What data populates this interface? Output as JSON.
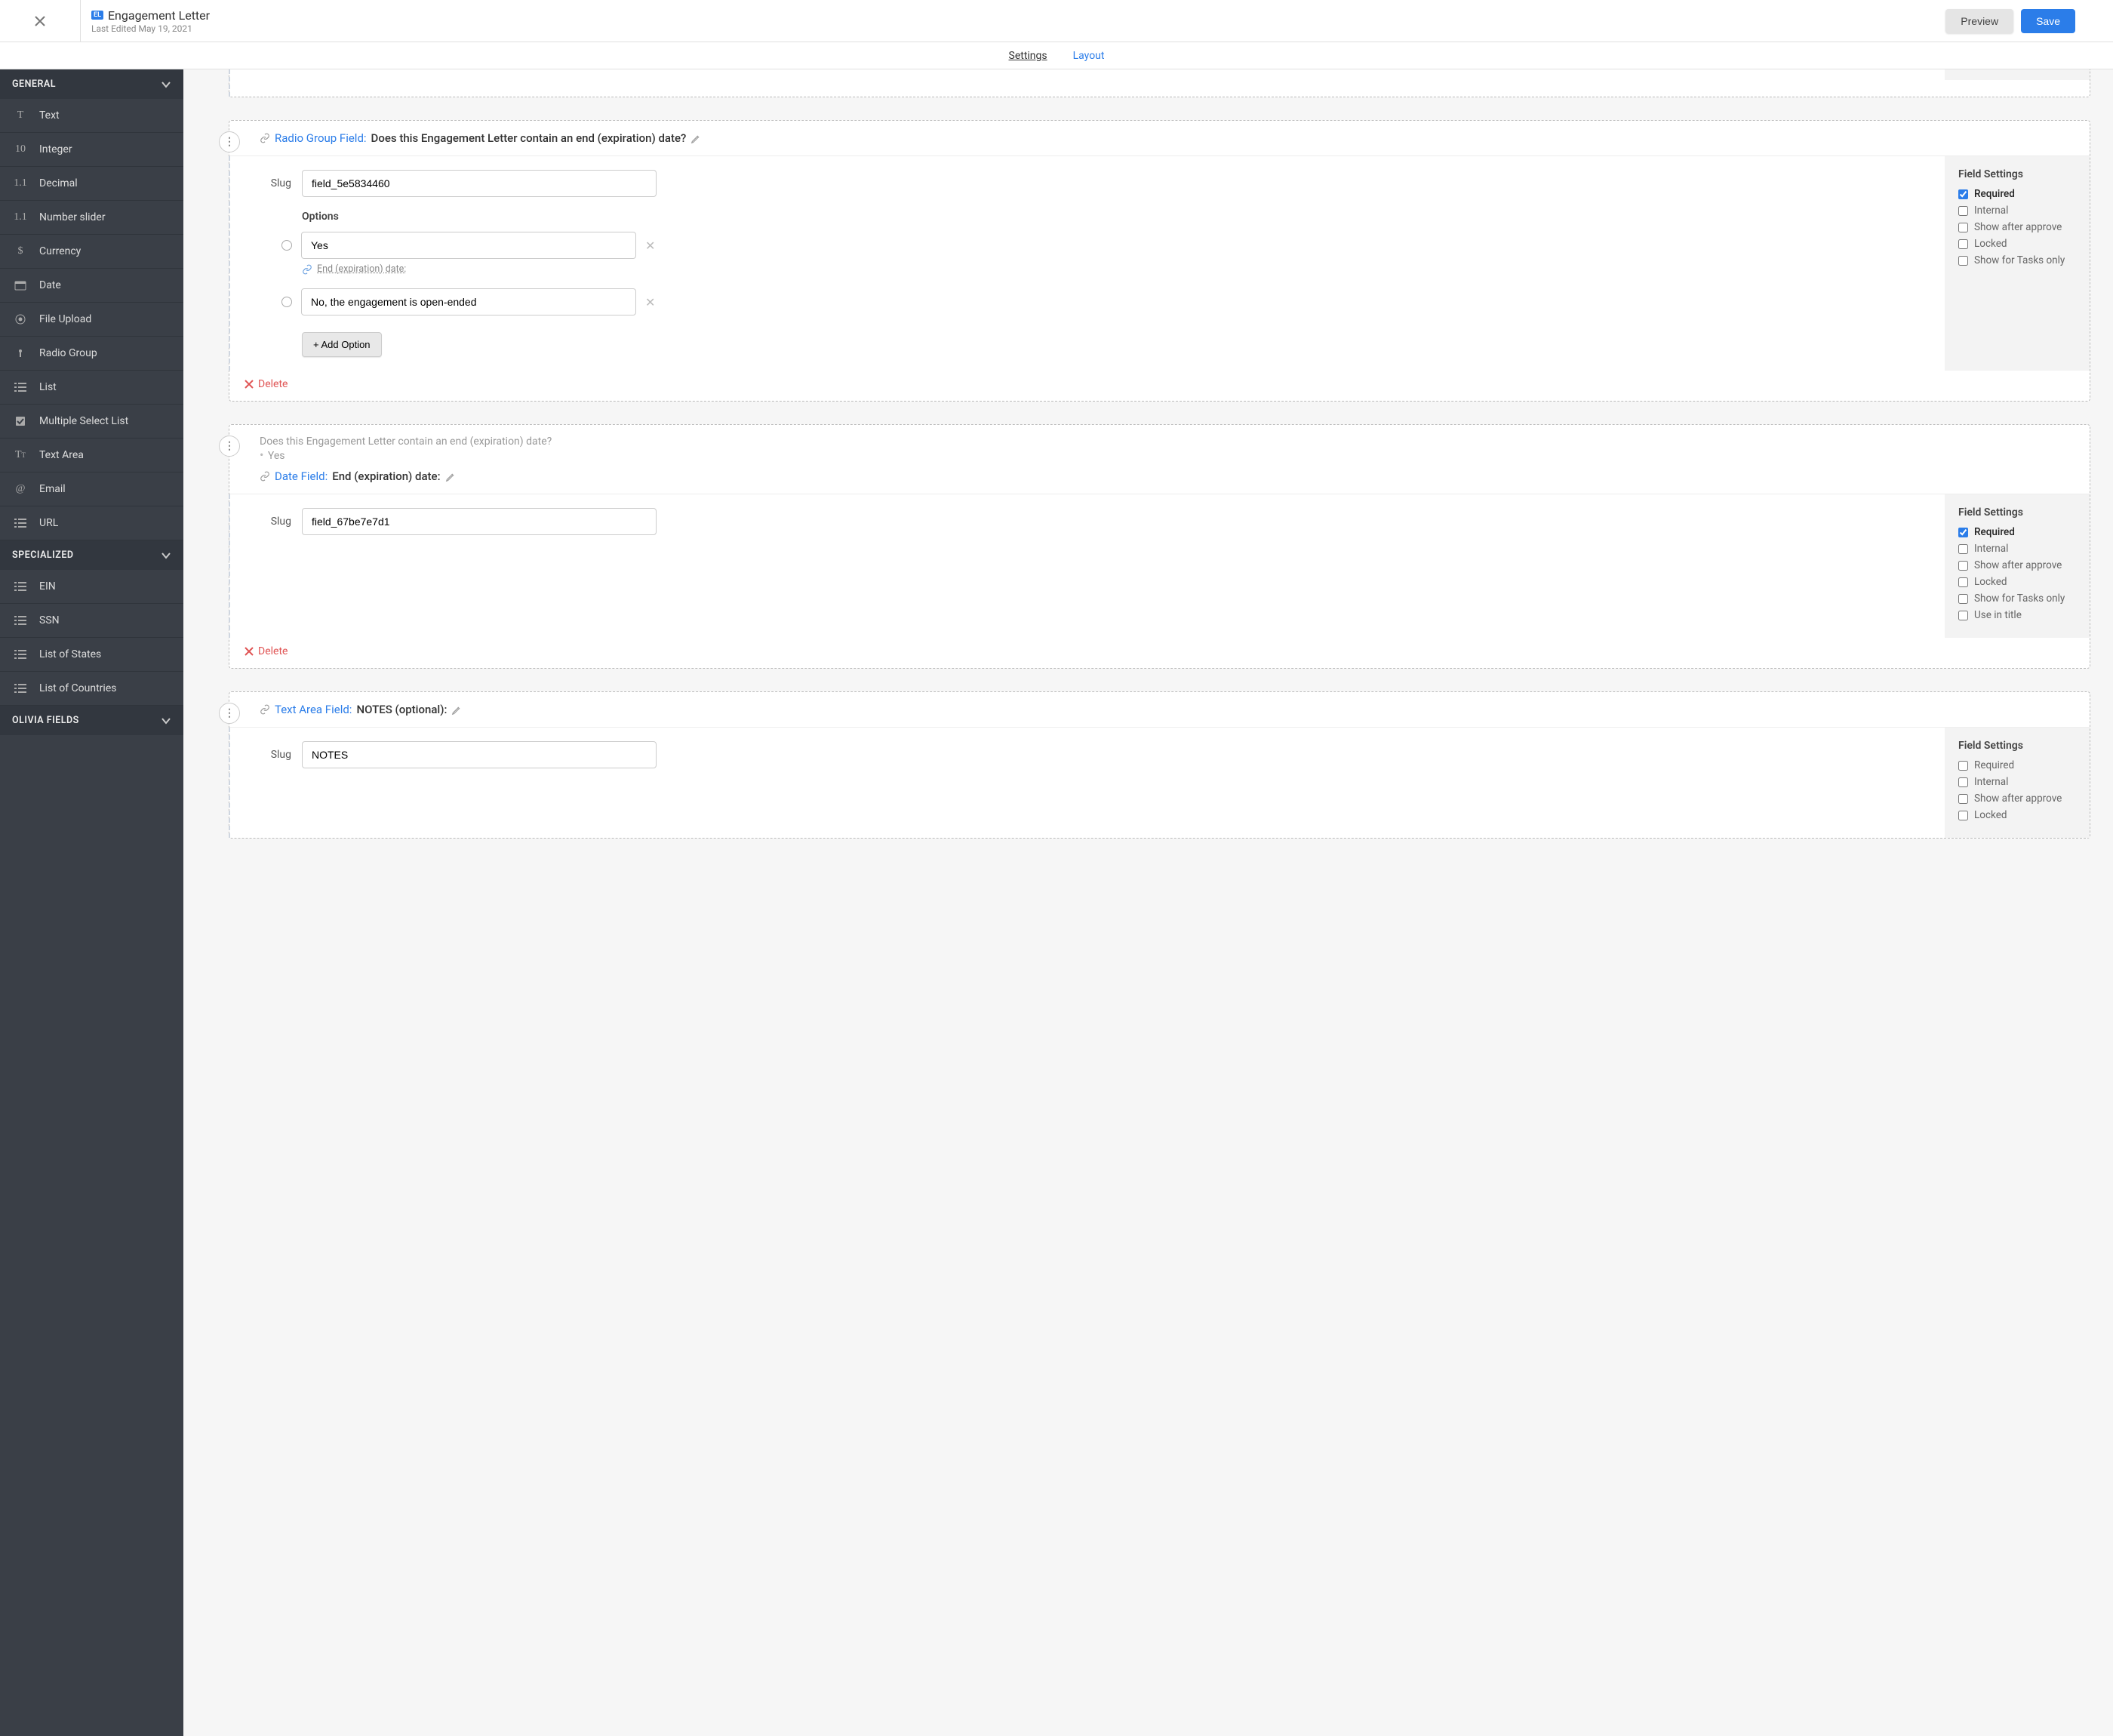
{
  "header": {
    "badge": "EL",
    "title": "Engagement Letter",
    "subtitle": "Last Edited May 19, 2021",
    "preview": "Preview",
    "save": "Save"
  },
  "tabs": {
    "settings": "Settings",
    "layout": "Layout"
  },
  "sidebar": {
    "sections": [
      {
        "title": "GENERAL",
        "items": [
          {
            "icon": "T",
            "label": "Text"
          },
          {
            "icon": "10",
            "label": "Integer"
          },
          {
            "icon": "1.1",
            "label": "Decimal"
          },
          {
            "icon": "1.1",
            "label": "Number slider"
          },
          {
            "icon": "$",
            "label": "Currency"
          },
          {
            "icon": "cal",
            "label": "Date"
          },
          {
            "icon": "dot",
            "label": "File Upload"
          },
          {
            "icon": "dot",
            "label": "Radio Group"
          },
          {
            "icon": "list",
            "label": "List"
          },
          {
            "icon": "check",
            "label": "Multiple Select List"
          },
          {
            "icon": "TT",
            "label": "Text Area"
          },
          {
            "icon": "@",
            "label": "Email"
          },
          {
            "icon": "list",
            "label": "URL"
          }
        ]
      },
      {
        "title": "SPECIALIZED",
        "items": [
          {
            "icon": "list",
            "label": "EIN"
          },
          {
            "icon": "list",
            "label": "SSN"
          },
          {
            "icon": "list",
            "label": "List of States"
          },
          {
            "icon": "list",
            "label": "List of Countries"
          }
        ]
      },
      {
        "title": "OLIVIA FIELDS",
        "items": []
      }
    ]
  },
  "common": {
    "slug_label": "Slug",
    "options_label": "Options",
    "add_option": "+ Add Option",
    "delete": "Delete",
    "field_settings": "Field Settings",
    "fs_required": "Required",
    "fs_internal": "Internal",
    "fs_show_after": "Show after approve",
    "fs_locked": "Locked",
    "fs_tasks_only": "Show for Tasks only",
    "fs_use_in_title": "Use in title"
  },
  "cards": [
    {
      "type": "Radio Group Field:",
      "name": "Does this Engagement Letter contain an end (expiration) date?",
      "slug": "field_5e5834460",
      "options": [
        {
          "value": "Yes",
          "link": "End (expiration) date:"
        },
        {
          "value": "No, the engagement is open-ended"
        }
      ],
      "settings": {
        "required": true,
        "internal": false,
        "show_after": false,
        "locked": false,
        "tasks_only": false
      }
    },
    {
      "condition_q": "Does this Engagement Letter contain an end (expiration) date?",
      "condition_a": "Yes",
      "type": "Date Field:",
      "name": "End (expiration) date:",
      "slug": "field_67be7e7d1",
      "settings": {
        "required": true,
        "internal": false,
        "show_after": false,
        "locked": false,
        "tasks_only": false,
        "use_in_title": false
      }
    },
    {
      "type": "Text Area Field:",
      "name": "NOTES (optional):",
      "slug": "NOTES",
      "settings": {
        "required": false,
        "internal": false,
        "show_after": false,
        "locked": false
      }
    }
  ]
}
